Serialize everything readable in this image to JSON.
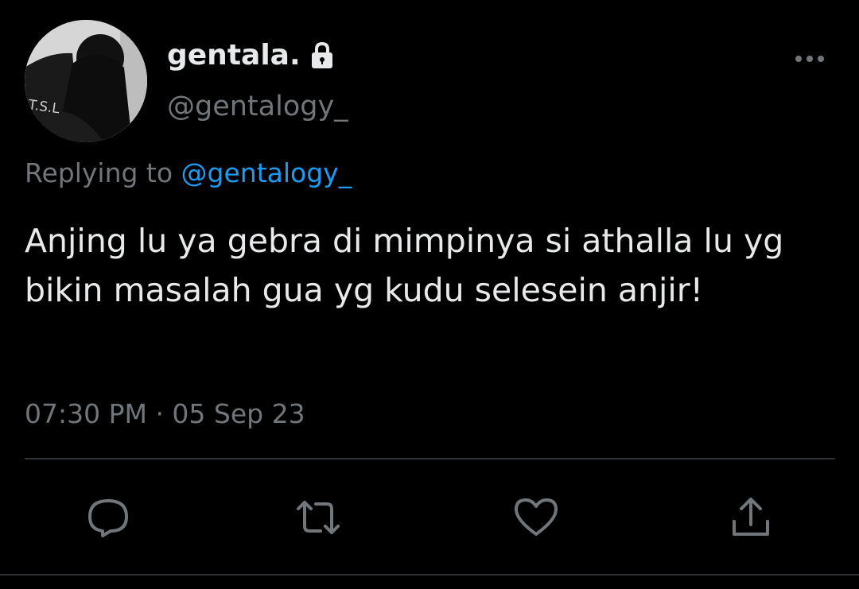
{
  "tweet": {
    "author": {
      "display_name": "gentala.",
      "handle": "@gentalogy_",
      "avatar_text": "T.S.L"
    },
    "reply_context": {
      "prefix": "Replying to",
      "mention": "@gentalogy_"
    },
    "text": "Anjing lu ya gebra di mimpinya si athalla lu yg bikin masalah gua yg kudu selesein anjir!",
    "timestamp": "07:30 PM · 05 Sep 23"
  },
  "icons": {
    "lock": "lock-icon",
    "more": "more-icon",
    "reply": "reply-icon",
    "retweet": "retweet-icon",
    "like": "like-icon",
    "share": "share-icon"
  },
  "colors": {
    "background": "#000000",
    "primary_text": "#e7e9ea",
    "secondary_text": "#71767b",
    "accent": "#1d9bf0",
    "divider": "#2f3336"
  }
}
